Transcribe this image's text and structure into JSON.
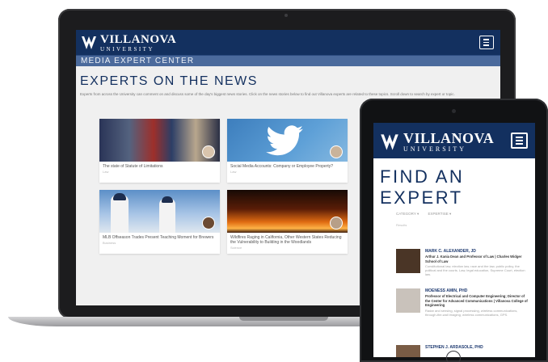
{
  "laptop": {
    "logo": {
      "main": "VILLANOVA",
      "sub": "UNIVERSITY"
    },
    "subbar": "MEDIA EXPERT CENTER",
    "section_title": "EXPERTS ON THE NEWS",
    "intro": "Experts from across the University can comment on and discuss some of the day's biggest news stories. Click on the news stories below to find out Villanova experts are related to these topics. Scroll down to search by expert or topic.",
    "cards": [
      {
        "caption": "The state of Statute of Limitations",
        "meta": "Law"
      },
      {
        "caption": "Social Media Accounts: Company or Employee Property?",
        "meta": "Law"
      },
      {
        "caption": "MLB Offseason Trades Present Teaching Moment for Brewers",
        "meta": "Business"
      },
      {
        "caption": "Wildfires Raging in California, Other Western States Reducing the Vulnerability to Building in the Woodlands",
        "meta": "Science"
      }
    ]
  },
  "tablet": {
    "logo": {
      "main": "VILLANOVA",
      "sub": "UNIVERSITY"
    },
    "title": "FIND AN EXPERT",
    "filters": [
      "CATEGORY ▾",
      "EXPERTISE ▾"
    ],
    "results_label": "Results",
    "experts": [
      {
        "name": "MARK C. ALEXANDER, JD",
        "role": "Arthur J. Kania Dean and Professor of Law | Charles Widger School of Law",
        "blurb": "Constitutional law, election law, race and the law, public policy, the political and the courts. Law, legal education, Supreme Court, election law."
      },
      {
        "name": "MOENESS AMIN, PHD",
        "role": "Professor of Electrical and Computer Engineering; Director of the Center for Advanced Communications | Villanova College of Engineering",
        "blurb": "Radar and sensing, signal processing, wireless communications, through-the-wall imaging, wireless communications, GPS."
      },
      {
        "name": "STEPHEN J. ARDASOLE, PHD",
        "role": "",
        "blurb": ""
      }
    ]
  },
  "colors": {
    "brand_navy": "#13305f",
    "subbar_blue": "#4b6a9c"
  }
}
